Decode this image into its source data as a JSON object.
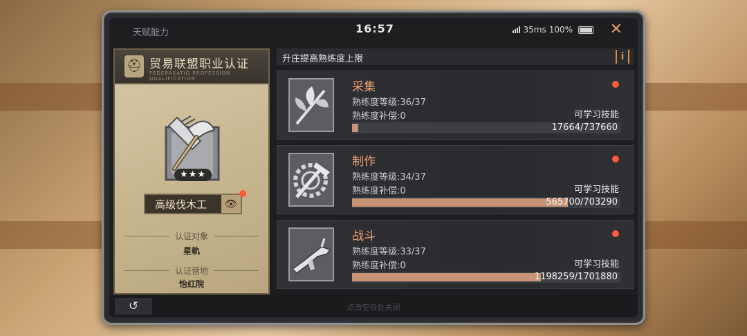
{
  "window": {
    "title": "天赋能力",
    "clock": "16:57",
    "ping": "35ms",
    "battery": "100%"
  },
  "left": {
    "header_title": "贸易联盟职业认证",
    "header_sub": "FEDERASATIO PROFESSION  QUALIFICATION",
    "class_name": "高级伐木工",
    "star_count": 3,
    "target_label": "认证对象",
    "target_value": "星軌",
    "camp_label": "认证营地",
    "camp_value": "怡红院"
  },
  "right": {
    "header": "升庄提高熟练度上限",
    "info_icon": "i",
    "cards": [
      {
        "name": "采集",
        "level": "熟练度等级:36/37",
        "compensation": "熟练度补偿:0",
        "learn": "可学习技能",
        "progress": "17664/737660",
        "fraction": 0.024,
        "icon": "leaf-icon"
      },
      {
        "name": "制作",
        "level": "熟练度等级:34/37",
        "compensation": "熟练度补偿:0",
        "learn": "可学习技能",
        "progress": "565700/703290",
        "fraction": 0.804,
        "icon": "hammer-gear-icon"
      },
      {
        "name": "战斗",
        "level": "熟练度等级:33/37",
        "compensation": "熟练度补偿:0",
        "learn": "可学习技能",
        "progress": "1198259/1701880",
        "fraction": 0.704,
        "icon": "gun-icon"
      }
    ]
  },
  "bottom": {
    "back_icon": "↺",
    "hint": "点击空白处关闭"
  },
  "colors": {
    "accent": "#f0a070",
    "bar_fill": "#c89478",
    "alert": "#ff5a3a"
  }
}
